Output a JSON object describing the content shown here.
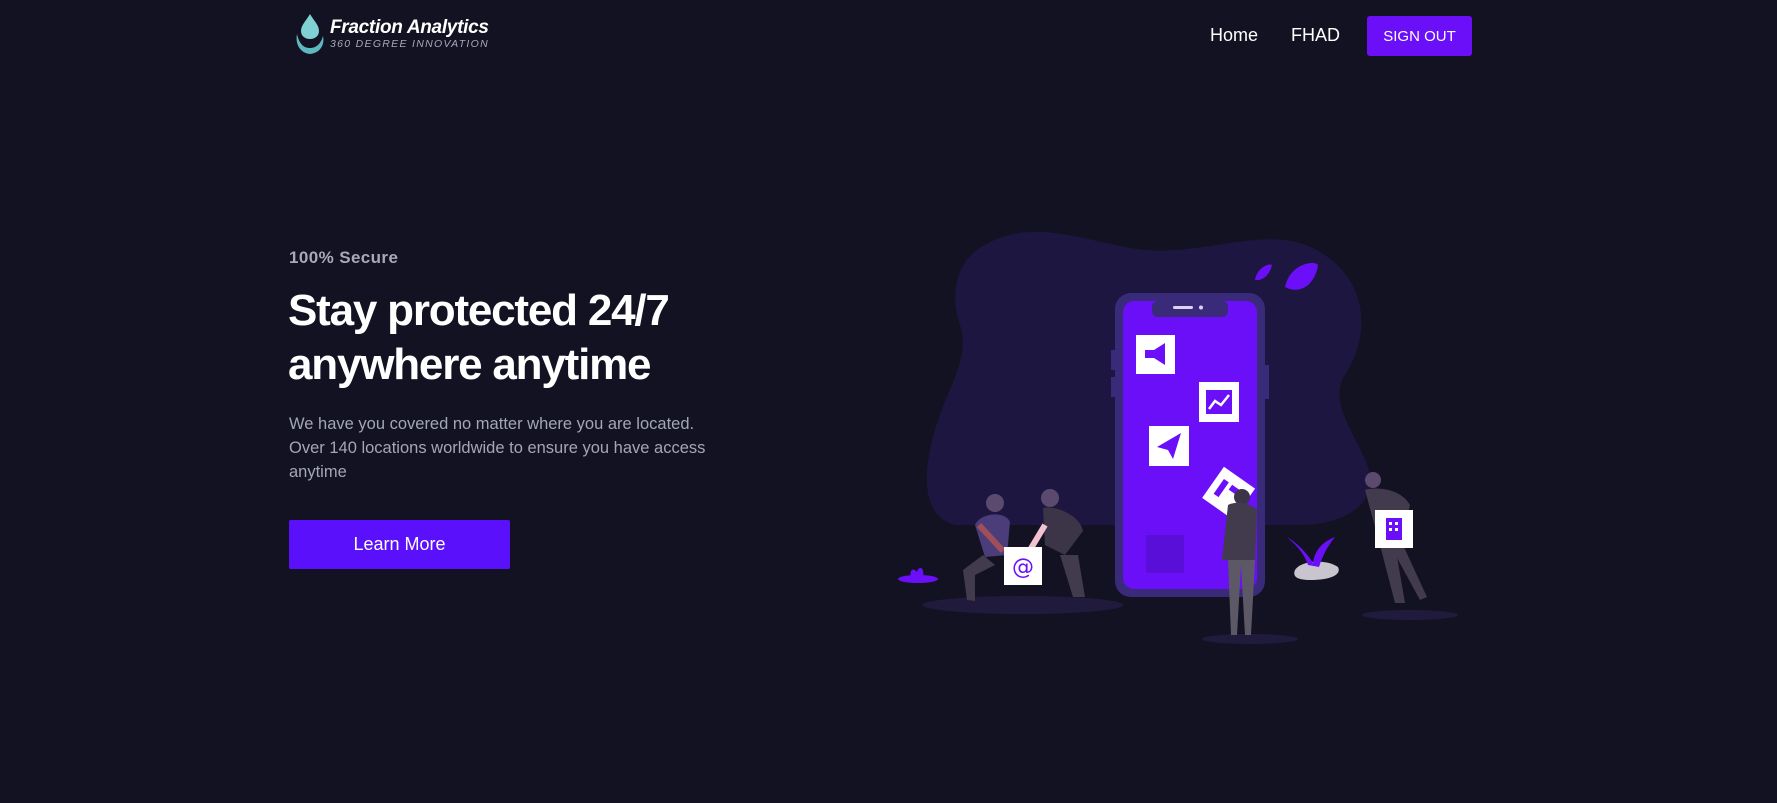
{
  "brand": {
    "name": "Fraction Analytics",
    "tagline": "360 DEGREE INNOVATION",
    "logo_icon": "water-drop-logo-icon"
  },
  "nav": {
    "links": [
      "Home",
      "FHAD"
    ],
    "signout_label": "SIGN OUT"
  },
  "hero": {
    "eyebrow": "100% Secure",
    "headline_lines": [
      "Stay protected 24/7",
      "anywhere anytime"
    ],
    "description_lines": [
      "We have you covered no matter where you are located.",
      "Over 140 locations worldwide to ensure you have access",
      "anytime"
    ],
    "cta_label": "Learn More"
  },
  "illustration": {
    "icons": [
      "megaphone-icon",
      "chart-icon",
      "paper-plane-icon",
      "at-sign-icon",
      "building-icon",
      "document-icon",
      "leaf-icon",
      "plant-icon"
    ],
    "subject": "people-with-phone-illustration"
  },
  "colors": {
    "background": "#131222",
    "accent": "#6a0ff8",
    "cta": "#5b10fb",
    "muted_text": "#a7a9b8",
    "blob": "#1c1640"
  }
}
